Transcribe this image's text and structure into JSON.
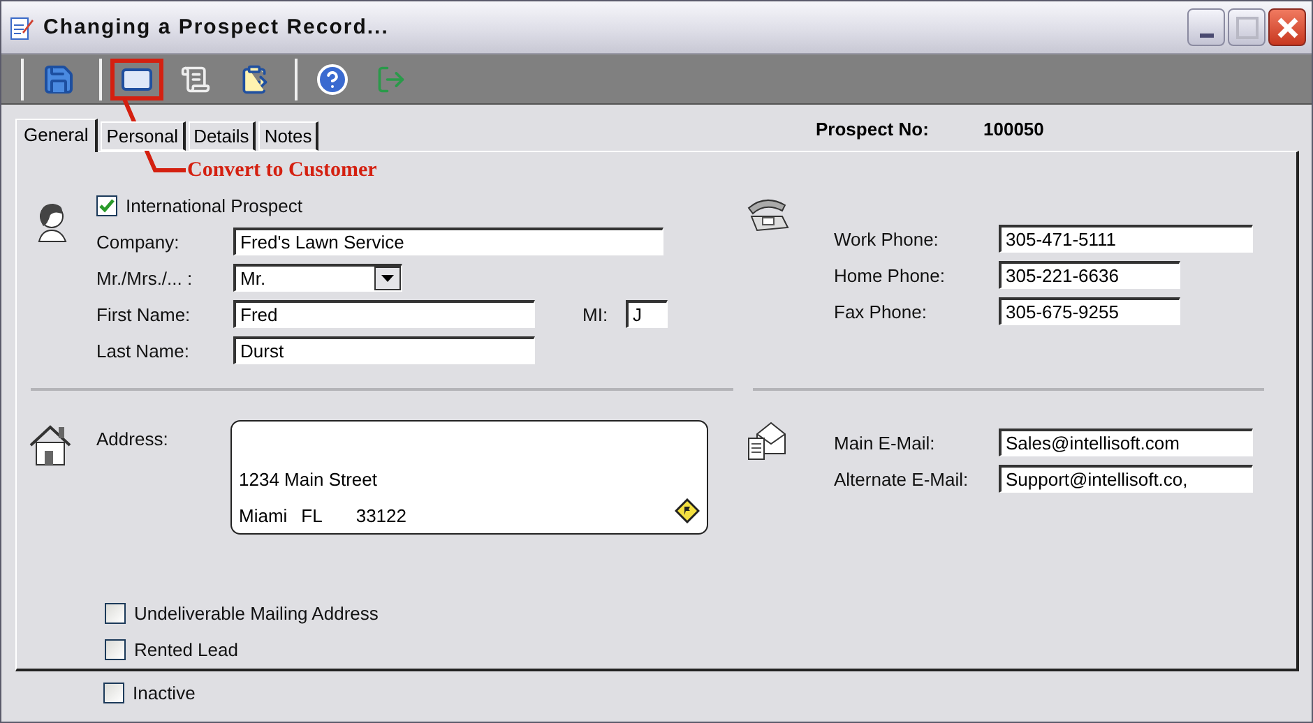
{
  "window": {
    "title": "Changing a Prospect Record..."
  },
  "annotation": {
    "text": "Convert to Customer"
  },
  "tabs": [
    {
      "label": "General",
      "selected": true
    },
    {
      "label": "Personal",
      "selected": false
    },
    {
      "label": "Details",
      "selected": false
    },
    {
      "label": "Notes",
      "selected": false
    }
  ],
  "prospect_no": {
    "label": "Prospect No:",
    "value": "100050"
  },
  "international": {
    "label": "International Prospect",
    "checked": true
  },
  "name_fields": [
    {
      "kind": "text",
      "label": "Company:",
      "value": "Fred's Lawn Service"
    },
    {
      "kind": "select",
      "label": "Mr./Mrs./... :",
      "value": "Mr."
    },
    {
      "kind": "text",
      "label": "First Name:",
      "value": "Fred"
    },
    {
      "kind": "text",
      "label": "Last Name:",
      "value": "Durst"
    }
  ],
  "middle_initial": {
    "label": "MI:",
    "value": "J"
  },
  "phones": [
    {
      "label": "Work Phone:",
      "value": "305-471-5111"
    },
    {
      "label": "Home Phone:",
      "value": "305-221-6636"
    },
    {
      "label": "Fax Phone:",
      "value": "305-675-9255"
    }
  ],
  "address": {
    "label": "Address:",
    "street": "1234 Main Street",
    "city": "Miami",
    "state": "FL",
    "zip": "33122"
  },
  "emails": [
    {
      "label": "Main E-Mail:",
      "value": "Sales@intellisoft.com"
    },
    {
      "label": "Alternate E-Mail:",
      "value": "Support@intellisoft.co,"
    }
  ],
  "flags": [
    {
      "label": "Undeliverable Mailing Address",
      "checked": false
    },
    {
      "label": "Rented Lead",
      "checked": false
    }
  ],
  "inactive": {
    "label": "Inactive",
    "checked": false
  }
}
